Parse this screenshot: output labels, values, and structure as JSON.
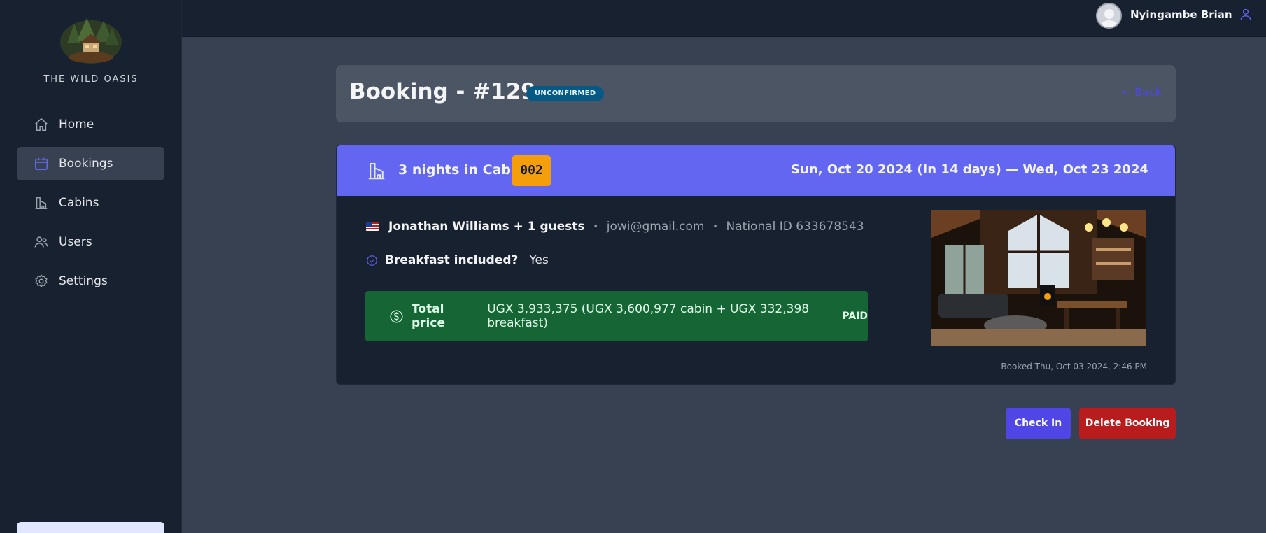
{
  "app": {
    "name": "THE WILD OASIS"
  },
  "sidebar": {
    "items": [
      {
        "label": "Home",
        "icon": "home-icon"
      },
      {
        "label": "Bookings",
        "icon": "calendar-icon",
        "active": true
      },
      {
        "label": "Cabins",
        "icon": "cabin-icon"
      },
      {
        "label": "Users",
        "icon": "users-icon"
      },
      {
        "label": "Settings",
        "icon": "gear-icon"
      }
    ]
  },
  "header": {
    "user_name": "Nyingambe Brian"
  },
  "booking": {
    "title": "Booking - #129",
    "status": "UNCONFIRMED",
    "back_label": "← Back",
    "nights_text": "3 nights in Cabin",
    "cabin_number": "002",
    "dates": "Sun, Oct 20 2024 (In 14 days) — Wed, Oct 23 2024",
    "guest": {
      "name": "Jonathan Williams + 1 guests",
      "email": "jowi@gmail.com",
      "national_id": "National ID 633678543",
      "separator": "•"
    },
    "breakfast": {
      "label": "Breakfast included?",
      "value": "Yes"
    },
    "price": {
      "label": "Total price",
      "value": "UGX 3,933,375 (UGX 3,600,977 cabin + UGX 332,398 breakfast)",
      "status": "PAID"
    },
    "booked_at": "Booked Thu, Oct 03 2024, 2:46 PM"
  },
  "actions": {
    "check_in": "Check In",
    "delete": "Delete Booking"
  },
  "colors": {
    "accent": "#6366f1",
    "status_unconfirmed": "#075985",
    "paid_green": "#166534",
    "cabin_badge": "#f59e0b",
    "danger": "#b91c1c"
  }
}
